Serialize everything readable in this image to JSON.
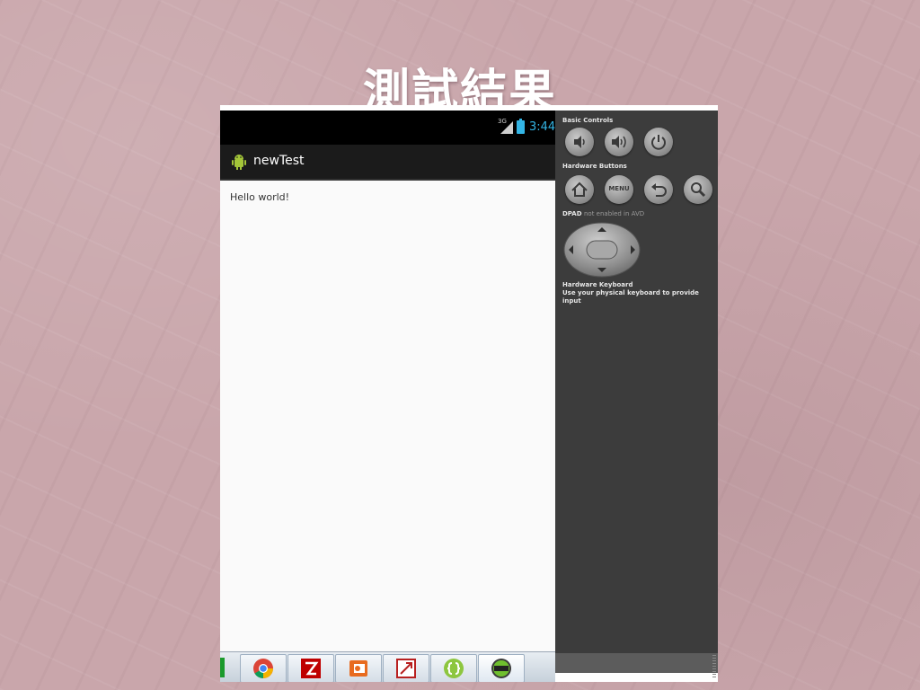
{
  "slide": {
    "title": "測試結果"
  },
  "status_bar": {
    "network": "3G",
    "time": "3:44"
  },
  "app": {
    "title": "newTest",
    "body_text": "Hello world!"
  },
  "controls": {
    "basic_controls_label": "Basic Controls",
    "hardware_buttons_label": "Hardware Buttons",
    "dpad_label_prefix": "DPAD",
    "dpad_label_suffix": "not enabled in AVD",
    "keyboard_label": "Hardware Keyboard",
    "keyboard_hint": "Use your physical keyboard to provide input",
    "menu_label": "MENU",
    "buttons_basic": [
      "volume-down-icon",
      "volume-up-icon",
      "power-icon"
    ],
    "buttons_hardware": [
      "home-icon",
      "menu",
      "back-icon",
      "search-icon"
    ]
  },
  "taskbar": {
    "apps": [
      "chrome-icon",
      "filezilla-icon",
      "powerpoint-icon",
      "red-app-icon",
      "code-editor-icon",
      "android-avd-icon"
    ]
  },
  "colors": {
    "accent": "#33b5e5",
    "panel": "#3c3c3c",
    "android_green": "#a4c639"
  }
}
